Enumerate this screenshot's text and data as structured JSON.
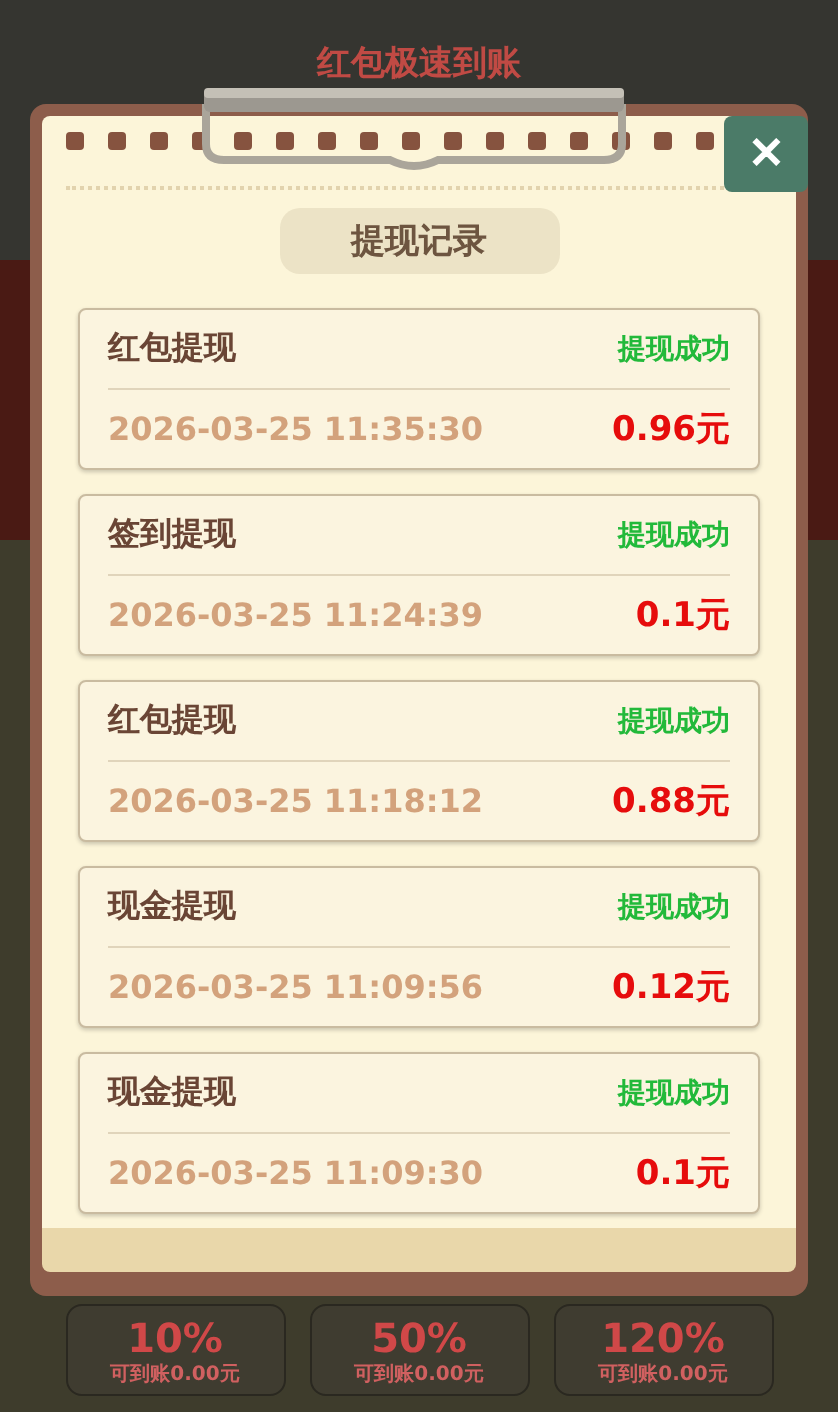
{
  "background": {
    "title": "红包极速到账",
    "tiers": [
      {
        "percent": "10%",
        "note": "可到账0.00元"
      },
      {
        "percent": "50%",
        "note": "可到账0.00元"
      },
      {
        "percent": "120%",
        "note": "可到账0.00元"
      }
    ]
  },
  "dialog": {
    "close": "✕",
    "title": "提现记录",
    "records": [
      {
        "type": "红包提现",
        "status": "提现成功",
        "time": "2026-03-25 11:35:30",
        "amount": "0.96元"
      },
      {
        "type": "签到提现",
        "status": "提现成功",
        "time": "2026-03-25 11:24:39",
        "amount": "0.1元"
      },
      {
        "type": "红包提现",
        "status": "提现成功",
        "time": "2026-03-25 11:18:12",
        "amount": "0.88元"
      },
      {
        "type": "现金提现",
        "status": "提现成功",
        "time": "2026-03-25 11:09:56",
        "amount": "0.12元"
      },
      {
        "type": "现金提现",
        "status": "提现成功",
        "time": "2026-03-25 11:09:30",
        "amount": "0.1元"
      }
    ]
  }
}
